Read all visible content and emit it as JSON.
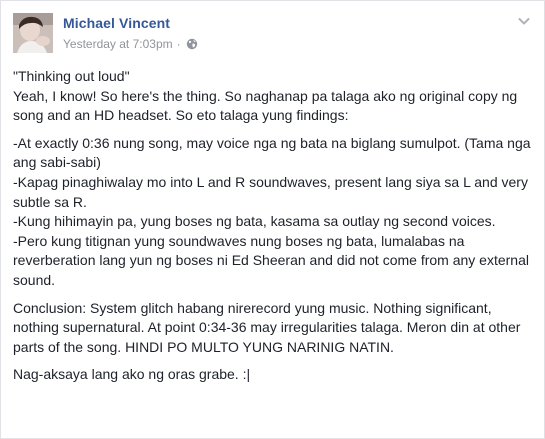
{
  "post": {
    "author": "Michael Vincent",
    "timestamp": "Yesterday at 7:03pm",
    "separator": "·",
    "privacy_icon": "globe-icon",
    "menu_icon": "chevron-down-icon",
    "paragraphs": [
      "\"Thinking out loud\"\nYeah, I know! So here's the thing. So naghanap pa talaga ako ng original copy ng song and an HD headset. So eto talaga yung findings:",
      "-At exactly 0:36 nung song, may voice nga ng bata na biglang sumulpot. (Tama nga ang sabi-sabi)\n-Kapag pinaghiwalay mo into L and R soundwaves, present lang siya sa L and very subtle sa R.\n-Kung hihimayin pa, yung boses ng bata, kasama sa outlay ng second voices.\n-Pero kung titignan yung soundwaves nung boses ng bata, lumalabas na reverberation lang yun ng boses ni Ed Sheeran and did not come from any external sound.",
      "Conclusion: System glitch habang nirerecord yung music. Nothing significant, nothing supernatural. At point 0:34-36 may irregularities talaga. Meron din at other parts of the song. HINDI PO MULTO YUNG NARINIG NATIN.",
      "Nag-aksaya lang ako ng oras grabe. :|"
    ]
  },
  "colors": {
    "author_link": "#365899",
    "meta_text": "#90949c",
    "body_text": "#1d2129",
    "border": "#e1e2e5"
  }
}
